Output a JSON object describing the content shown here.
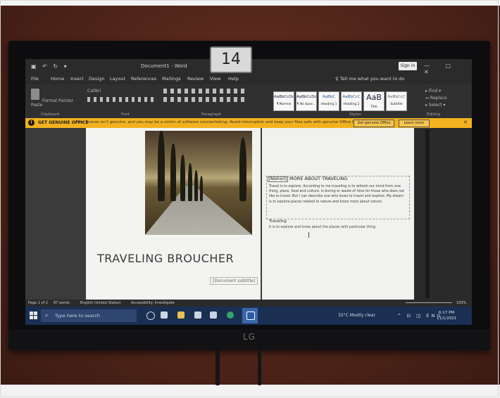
{
  "monitor": {
    "tag_number": "14",
    "brand": "LG"
  },
  "app": {
    "doc_title": "Document1 - Word",
    "sign_in": "Sign in",
    "window_controls": "— ▢ ✕",
    "quick_access": "▣ ↶ ↻ ▾",
    "tell_me": "♀ Tell me what you want to do"
  },
  "menu": {
    "items": [
      "File",
      "Home",
      "Insert",
      "Design",
      "Layout",
      "References",
      "Mailings",
      "Review",
      "View",
      "Help"
    ]
  },
  "ribbon": {
    "paste": "Paste",
    "format_painter": "Format Painter",
    "font_name": "Calibri",
    "clipboard_group": "Clipboard",
    "font_group": "Font",
    "paragraph_group": "Paragraph",
    "styles_group": "Styles",
    "editing_group": "Editing",
    "editing_find": "▸ Find ▾",
    "editing_replace": "↔ Replace",
    "editing_select": "▸ Select ▾",
    "styles": [
      {
        "sample": "AaBbCcDc",
        "label": "¶ Normal"
      },
      {
        "sample": "AaBbCcDc",
        "label": "¶ No Spac..."
      },
      {
        "sample": "AaBbC",
        "label": "Heading 1"
      },
      {
        "sample": "AaBbCcC",
        "label": "Heading 2"
      },
      {
        "sample": "AaB",
        "label": "Title"
      },
      {
        "sample": "AaBbCcC",
        "label": "Subtitle"
      }
    ]
  },
  "message_bar": {
    "icon": "!",
    "title": "GET GENUINE OFFICE",
    "text": "Your license isn't genuine, and you may be a victim of software counterfeiting. Avoid interruption and keep your files safe with genuine Office today.",
    "button_primary": "Get genuine Office",
    "button_secondary": "Learn more",
    "close": "✕"
  },
  "document": {
    "title": "TRAVELING BROUCHER",
    "subtitle": "[Document subtitle]",
    "right_heading_tag": "[Abstract]",
    "right_heading": "MORE ABOUT TRAVELING",
    "right_body": "Travel is to explore. According to me traveling is to refresh our mind from one thing, place, food and culture. Is boring or waste of time for those who does not like to travel. But I can describe one who loves to travel and explore. My dream is to explore places related to nature and know more about nature.",
    "right_subheading": "Traveling",
    "right_line": "It is to explore and know about the places with particular thing."
  },
  "status_bar": {
    "page": "Page 1 of 2",
    "words": "87 words",
    "language": "English (United States)",
    "accessibility": "Accessibility: Investigate",
    "zoom": "100%"
  },
  "taskbar": {
    "search_placeholder": "Type here to search",
    "weather": "32°C  Mostly clear",
    "tray": "^ ⊡ ◫ ENG",
    "time": "6:17 PM",
    "date": "11/1/2021"
  }
}
